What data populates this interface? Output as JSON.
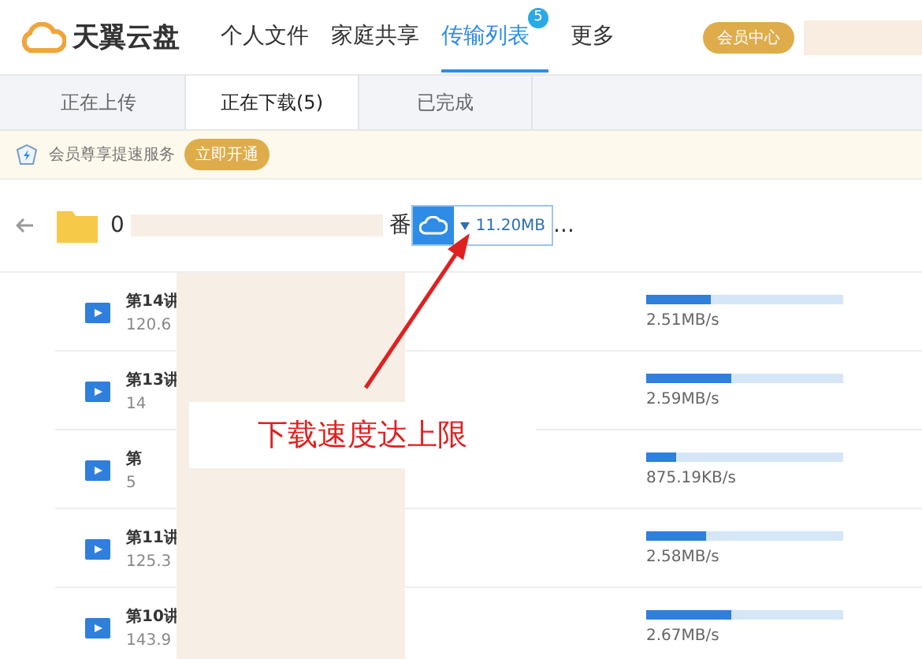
{
  "header": {
    "logo": "天翼云盘",
    "nav": [
      {
        "label": "个人文件",
        "selected": false
      },
      {
        "label": "家庭共享",
        "selected": false
      },
      {
        "label": "传输列表",
        "selected": true,
        "badge": "5"
      },
      {
        "label": "更多",
        "selected": false
      }
    ],
    "vip_button": "会员中心"
  },
  "tabs": [
    {
      "label": "正在上传",
      "selected": false
    },
    {
      "label": "正在下载(5)",
      "selected": true
    },
    {
      "label": "已完成",
      "selected": false
    }
  ],
  "banner": {
    "text": "会员尊享提速服务",
    "button": "立即开通"
  },
  "folder": {
    "name": "0",
    "name_tail": "番",
    "ellipsis": "...",
    "total_speed": "11.20MB"
  },
  "files": [
    {
      "name": "第14讲",
      "size": "120.6",
      "level": 0.33,
      "speed": "2.51MB/s"
    },
    {
      "name": "第13讲",
      "size": "14",
      "level": 0.43,
      "speed": "2.59MB/s"
    },
    {
      "name": "第",
      "size": "5",
      "level": 0.15,
      "speed": "875.19KB/s"
    },
    {
      "name": "第11讲",
      "size": "125.3",
      "level": 0.3,
      "speed": "2.58MB/s"
    },
    {
      "name": "第10讲",
      "size": "143.9",
      "level": 0.43,
      "speed": "2.67MB/s"
    }
  ],
  "annotation": {
    "text": "下载速度达上限"
  }
}
